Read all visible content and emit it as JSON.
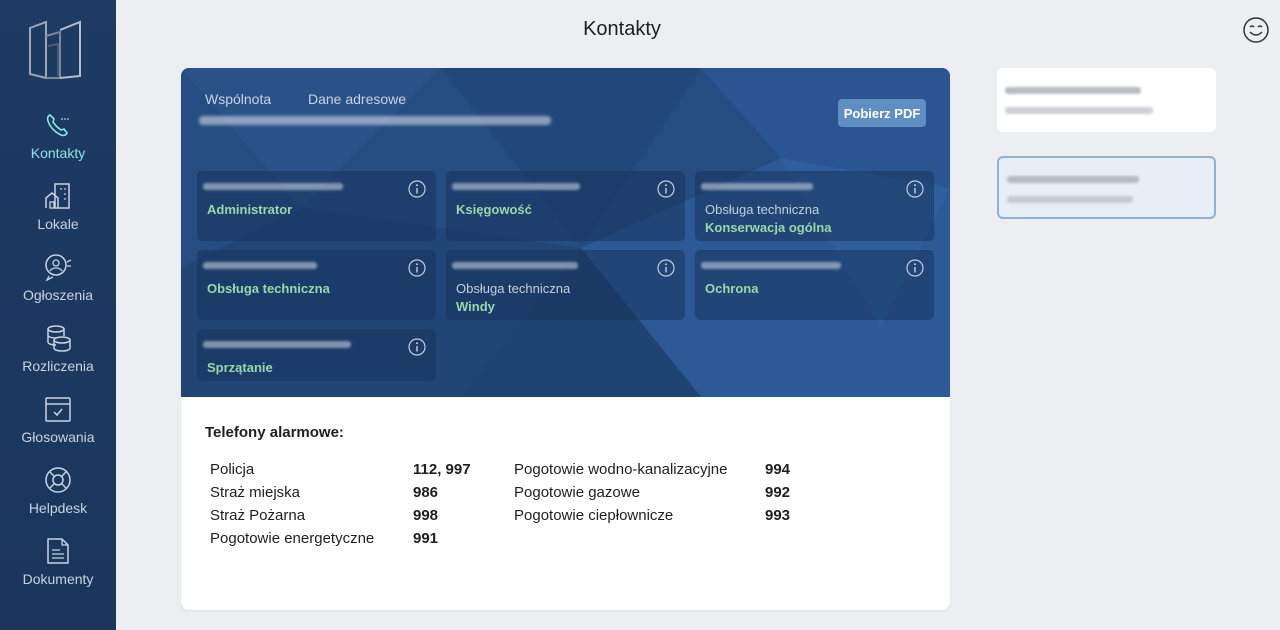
{
  "header": {
    "title": "Kontakty"
  },
  "sidebar": {
    "items": [
      {
        "label": "Kontakty",
        "icon": "phone-icon",
        "active": true
      },
      {
        "label": "Lokale",
        "icon": "building-icon",
        "active": false
      },
      {
        "label": "Ogłoszenia",
        "icon": "announcement-icon",
        "active": false
      },
      {
        "label": "Rozliczenia",
        "icon": "coins-icon",
        "active": false
      },
      {
        "label": "Głosowania",
        "icon": "calendar-check-icon",
        "active": false
      },
      {
        "label": "Helpdesk",
        "icon": "lifebuoy-icon",
        "active": false
      },
      {
        "label": "Dokumenty",
        "icon": "document-icon",
        "active": false
      }
    ]
  },
  "main": {
    "tabs": [
      {
        "label": "Wspólnota"
      },
      {
        "label": "Dane adresowe"
      }
    ],
    "pdf_button": "Pobierz PDF",
    "contacts": [
      {
        "role": "Administrator",
        "subrole": ""
      },
      {
        "role": "Księgowość",
        "subrole": ""
      },
      {
        "role": "Obsługa techniczna",
        "subrole": "Konserwacja ogólna"
      },
      {
        "role": "Obsługa techniczna",
        "subrole": ""
      },
      {
        "role": "Obsługa techniczna",
        "subrole": "Windy"
      },
      {
        "role": "Ochrona",
        "subrole": ""
      },
      {
        "role": "Sprzątanie",
        "subrole": ""
      }
    ],
    "alarm": {
      "title": "Telefony alarmowe:",
      "left": [
        {
          "name": "Policja",
          "number": "112, 997"
        },
        {
          "name": "Straż miejska",
          "number": "986"
        },
        {
          "name": "Straż Pożarna",
          "number": "998"
        },
        {
          "name": "Pogotowie energetyczne",
          "number": "991"
        }
      ],
      "right": [
        {
          "name": "Pogotowie wodno-kanalizacyjne",
          "number": "994"
        },
        {
          "name": "Pogotowie gazowe",
          "number": "992"
        },
        {
          "name": "Pogotowie ciepłownicze",
          "number": "993"
        }
      ]
    }
  },
  "colors": {
    "sidebar": "#1d3b63",
    "accent": "#8fe3e6",
    "hero": "#264d82",
    "role_text": "#9ad7a9",
    "pdf_button": "#5f8fc0"
  }
}
